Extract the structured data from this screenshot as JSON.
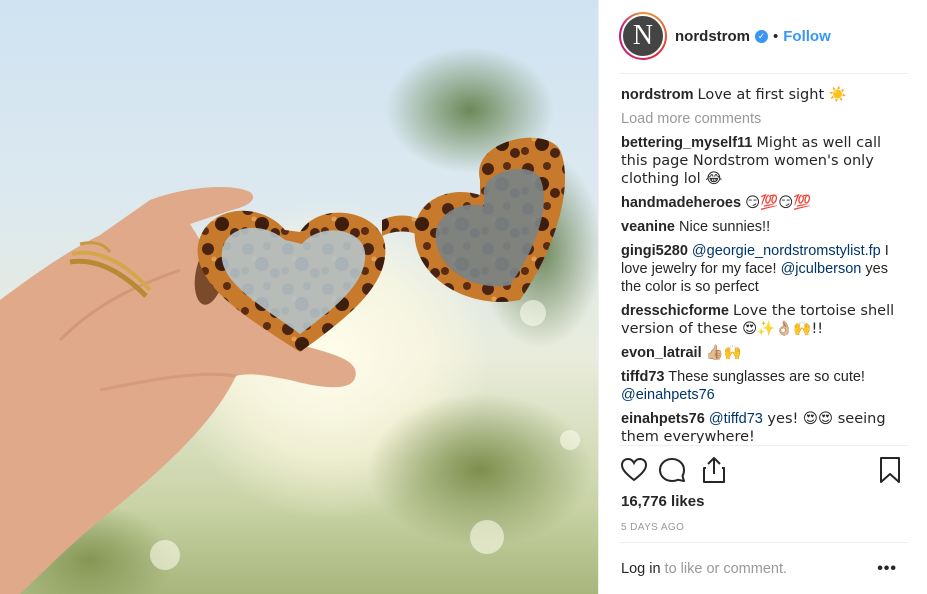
{
  "post": {
    "account": {
      "username": "nordstrom",
      "avatar_letter": "N",
      "verified_icon": "verified-check-icon",
      "separator": "•",
      "follow_label": "Follow"
    },
    "caption": {
      "user": "nordstrom",
      "text": "Love at first sight ☀️"
    },
    "load_more_label": "Load more comments",
    "comments": [
      {
        "user": "bettering_myself11",
        "text": "Might as well call this page Nordstrom women's only clothing lol 😂"
      },
      {
        "user": "handmadeheroes",
        "text": "😏💯😏💯"
      },
      {
        "user": "veanine",
        "text": "Nice sunnies!!"
      },
      {
        "user": "gingi5280",
        "mention1": "@georgie_nordstromstylist.fp",
        "text1": " I love jewelry for my face! ",
        "mention2": "@jculberson",
        "text2": " yes the color is so perfect"
      },
      {
        "user": "dresschicforme",
        "text": "Love the tortoise shell version of these 😍✨👌🏼🙌!!"
      },
      {
        "user": "evon_latrail",
        "text": "👍🏼🙌"
      },
      {
        "user": "tiffd73",
        "text": "These sunglasses are so cute! ",
        "mention": "@einahpets76"
      },
      {
        "user": "einahpets76",
        "mention": "@tiffd73",
        "text": " yes! 😍😍 seeing them everywhere!"
      }
    ],
    "actions": {
      "like_icon": "heart-icon",
      "comment_icon": "comment-bubble-icon",
      "share_icon": "share-icon",
      "save_icon": "bookmark-icon"
    },
    "likes_label": "16,776 likes",
    "age_label": "5 DAYS AGO",
    "login_link": "Log in",
    "login_suffix": " to like or comment.",
    "more_label": "•••"
  },
  "colors": {
    "link_blue": "#3897f0",
    "mention_blue": "#003569",
    "text": "#262626",
    "muted": "#999999",
    "divider": "#efefef"
  }
}
